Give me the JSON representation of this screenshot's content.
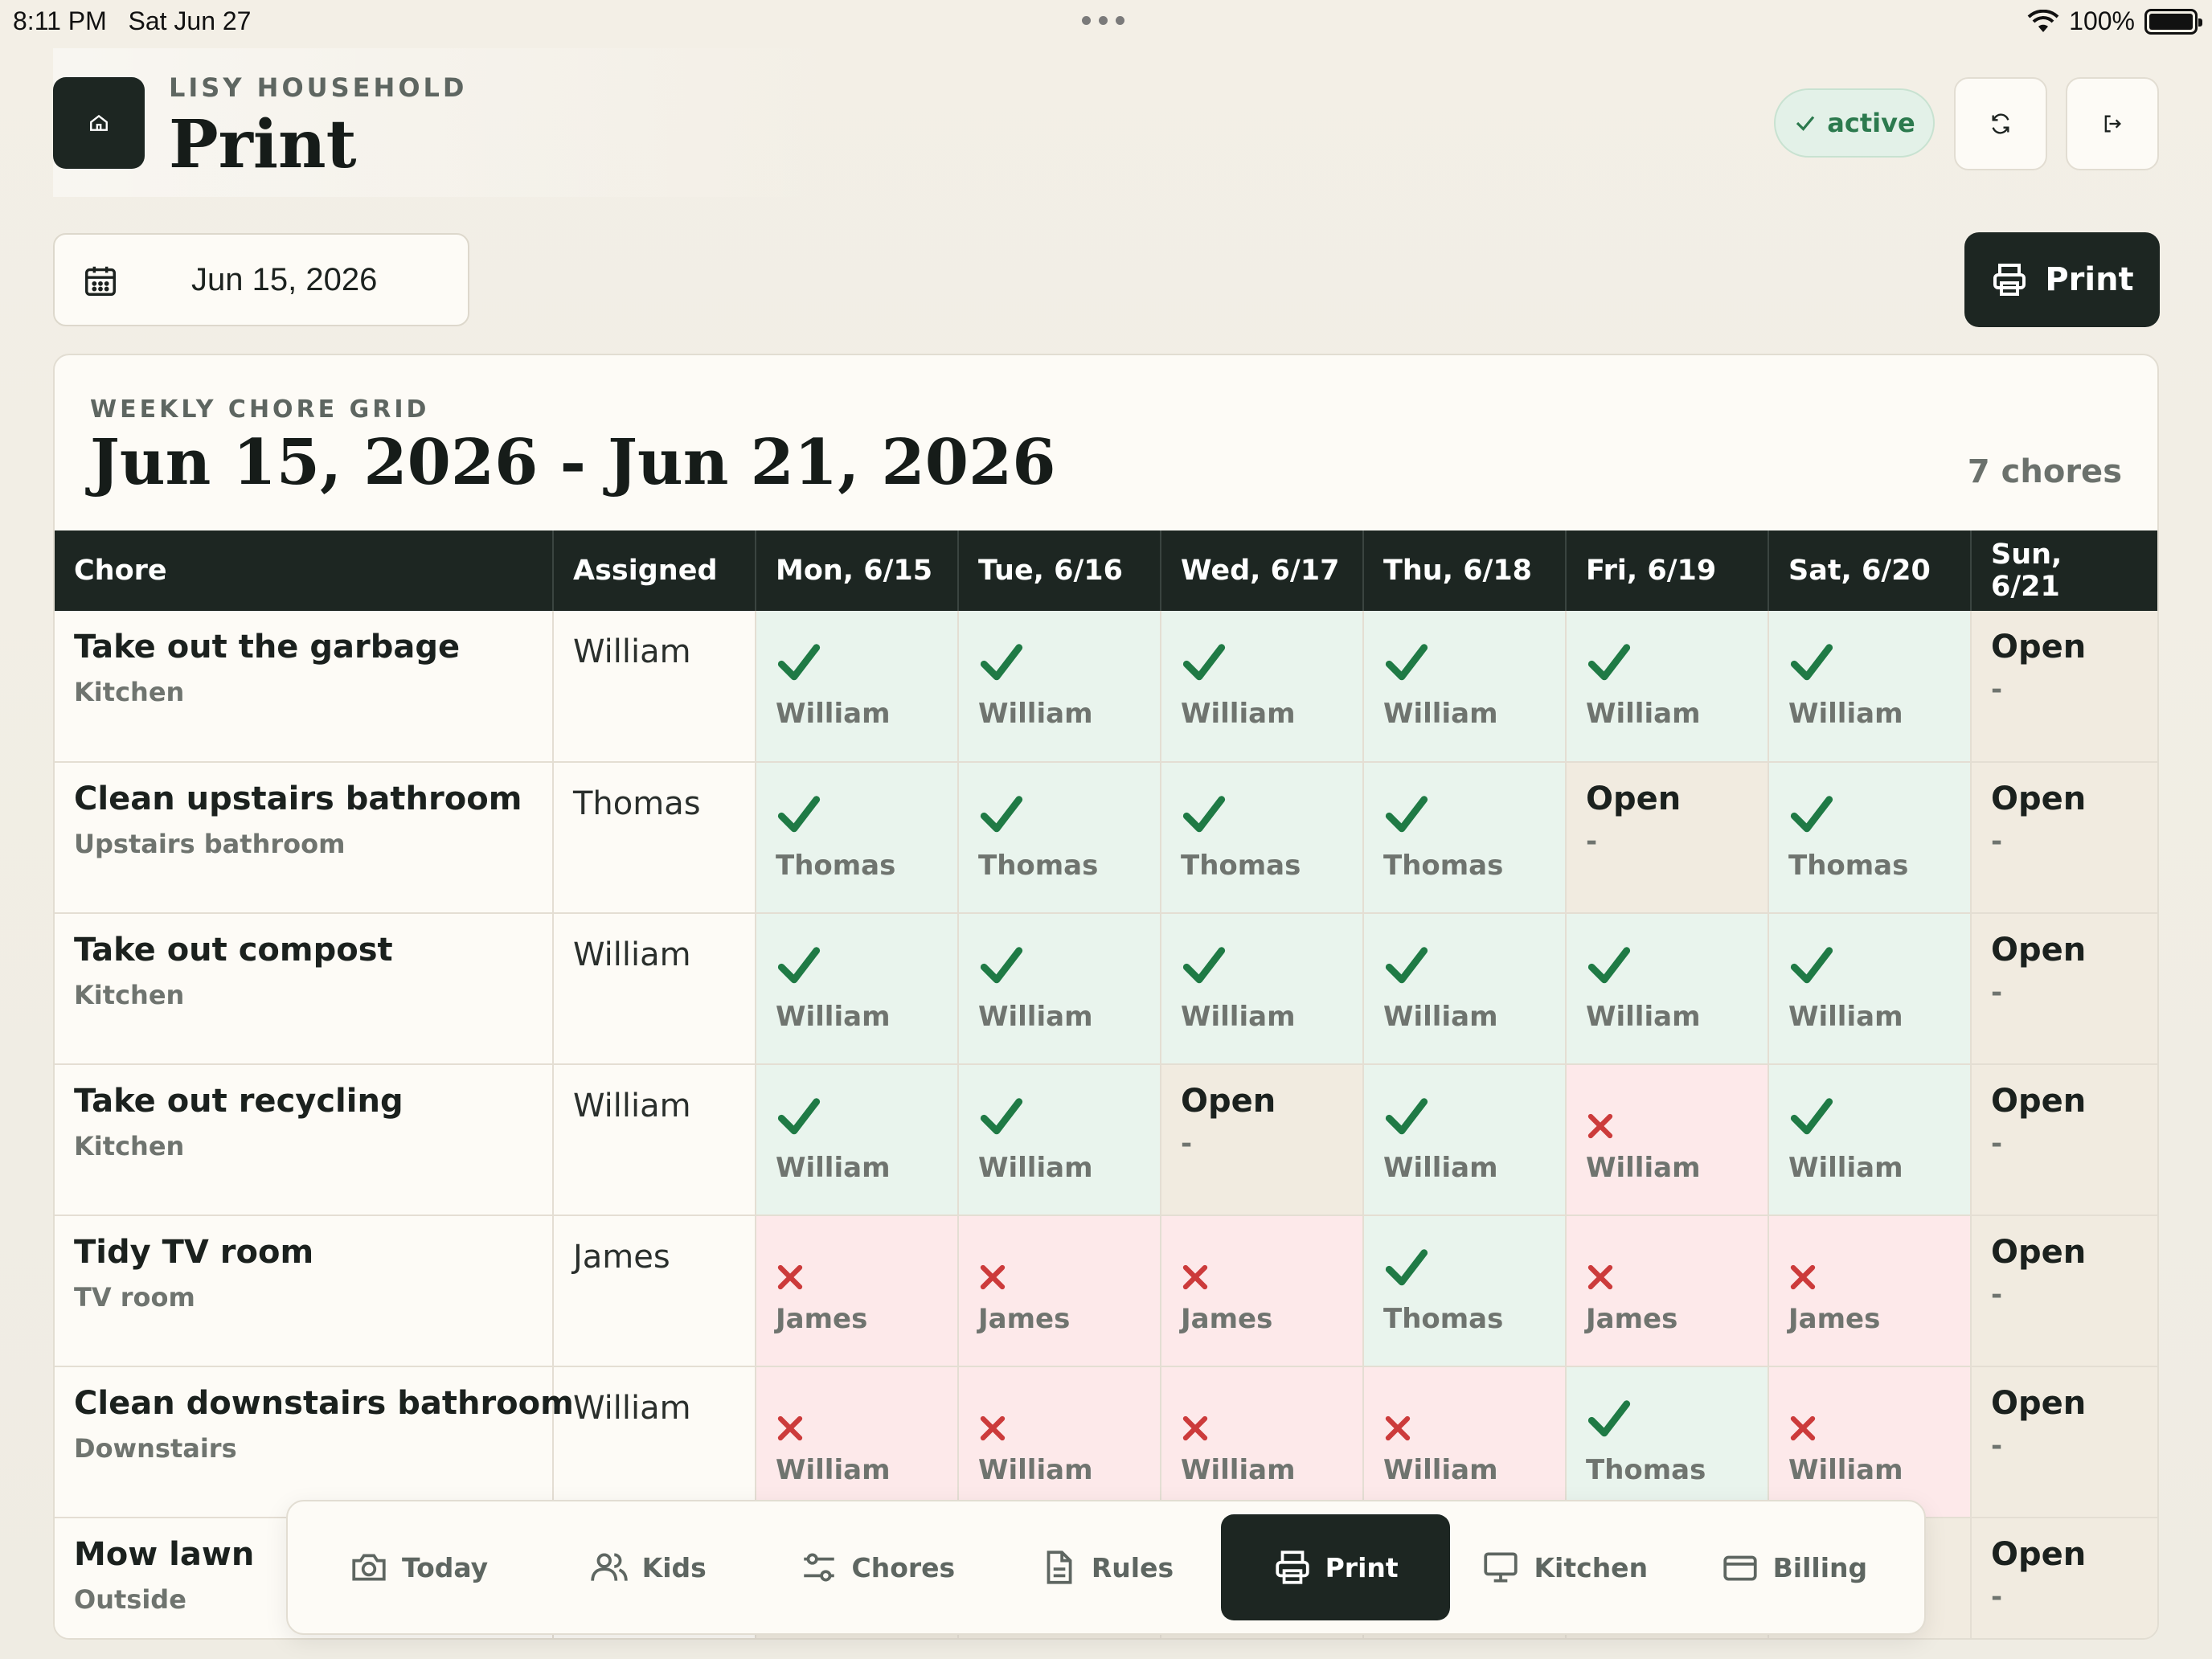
{
  "status_bar": {
    "time": "8:11 PM",
    "date": "Sat Jun 27",
    "battery": "100%"
  },
  "header": {
    "eyebrow": "LISY HOUSEHOLD",
    "title": "Print",
    "status": "active"
  },
  "controls": {
    "date": "Jun 15, 2026",
    "print_label": "Print"
  },
  "grid": {
    "eyebrow": "WEEKLY CHORE GRID",
    "title": "Jun 15, 2026 - Jun 21, 2026",
    "count": "7 chores",
    "columns": [
      "Chore",
      "Assigned",
      "Mon, 6/15",
      "Tue, 6/16",
      "Wed, 6/17",
      "Thu, 6/18",
      "Fri, 6/19",
      "Sat, 6/20",
      "Sun, 6/21"
    ],
    "open_label": "Open",
    "open_dash": "-",
    "rows": [
      {
        "name": "Take out the garbage",
        "room": "Kitchen",
        "assigned": "William",
        "cells": [
          {
            "s": "done",
            "who": "William"
          },
          {
            "s": "done",
            "who": "William"
          },
          {
            "s": "done",
            "who": "William"
          },
          {
            "s": "done",
            "who": "William"
          },
          {
            "s": "done",
            "who": "William"
          },
          {
            "s": "done",
            "who": "William"
          },
          {
            "s": "open",
            "who": ""
          }
        ]
      },
      {
        "name": "Clean upstairs bathroom",
        "room": "Upstairs bathroom",
        "assigned": "Thomas",
        "cells": [
          {
            "s": "done",
            "who": "Thomas"
          },
          {
            "s": "done",
            "who": "Thomas"
          },
          {
            "s": "done",
            "who": "Thomas"
          },
          {
            "s": "done",
            "who": "Thomas"
          },
          {
            "s": "open",
            "who": ""
          },
          {
            "s": "done",
            "who": "Thomas"
          },
          {
            "s": "open",
            "who": ""
          }
        ]
      },
      {
        "name": "Take out compost",
        "room": "Kitchen",
        "assigned": "William",
        "cells": [
          {
            "s": "done",
            "who": "William"
          },
          {
            "s": "done",
            "who": "William"
          },
          {
            "s": "done",
            "who": "William"
          },
          {
            "s": "done",
            "who": "William"
          },
          {
            "s": "done",
            "who": "William"
          },
          {
            "s": "done",
            "who": "William"
          },
          {
            "s": "open",
            "who": ""
          }
        ]
      },
      {
        "name": "Take out recycling",
        "room": "Kitchen",
        "assigned": "William",
        "cells": [
          {
            "s": "done",
            "who": "William"
          },
          {
            "s": "done",
            "who": "William"
          },
          {
            "s": "open",
            "who": ""
          },
          {
            "s": "done",
            "who": "William"
          },
          {
            "s": "missed",
            "who": "William"
          },
          {
            "s": "done",
            "who": "William"
          },
          {
            "s": "open",
            "who": ""
          }
        ]
      },
      {
        "name": "Tidy TV room",
        "room": "TV room",
        "assigned": "James",
        "cells": [
          {
            "s": "missed",
            "who": "James"
          },
          {
            "s": "missed",
            "who": "James"
          },
          {
            "s": "missed",
            "who": "James"
          },
          {
            "s": "done",
            "who": "Thomas"
          },
          {
            "s": "missed",
            "who": "James"
          },
          {
            "s": "missed",
            "who": "James"
          },
          {
            "s": "open",
            "who": ""
          }
        ]
      },
      {
        "name": "Clean downstairs bathroom",
        "room": "Downstairs",
        "assigned": "William",
        "cells": [
          {
            "s": "missed",
            "who": "William"
          },
          {
            "s": "missed",
            "who": "William"
          },
          {
            "s": "missed",
            "who": "William"
          },
          {
            "s": "missed",
            "who": "William"
          },
          {
            "s": "done",
            "who": "Thomas"
          },
          {
            "s": "missed",
            "who": "William"
          },
          {
            "s": "open",
            "who": ""
          }
        ]
      },
      {
        "name": "Mow lawn",
        "room": "Outside",
        "assigned": "",
        "cells": [
          {
            "s": "none",
            "who": ""
          },
          {
            "s": "none",
            "who": ""
          },
          {
            "s": "none",
            "who": ""
          },
          {
            "s": "none",
            "who": ""
          },
          {
            "s": "none",
            "who": ""
          },
          {
            "s": "none",
            "who": ""
          },
          {
            "s": "open",
            "who": ""
          }
        ]
      }
    ]
  },
  "nav": {
    "items": [
      {
        "label": "Today",
        "icon": "camera-icon"
      },
      {
        "label": "Kids",
        "icon": "users-icon"
      },
      {
        "label": "Chores",
        "icon": "sliders-icon"
      },
      {
        "label": "Rules",
        "icon": "document-icon"
      },
      {
        "label": "Print",
        "icon": "printer-icon",
        "active": true
      },
      {
        "label": "Kitchen",
        "icon": "monitor-icon"
      },
      {
        "label": "Billing",
        "icon": "card-icon"
      }
    ]
  },
  "colors": {
    "dark": "#1d2622",
    "done_bg": "#e9f4ed",
    "missed_bg": "#fde9ea",
    "open_bg": "#f1ebe0",
    "check": "#1f7a45",
    "cross": "#cc3b3b"
  }
}
